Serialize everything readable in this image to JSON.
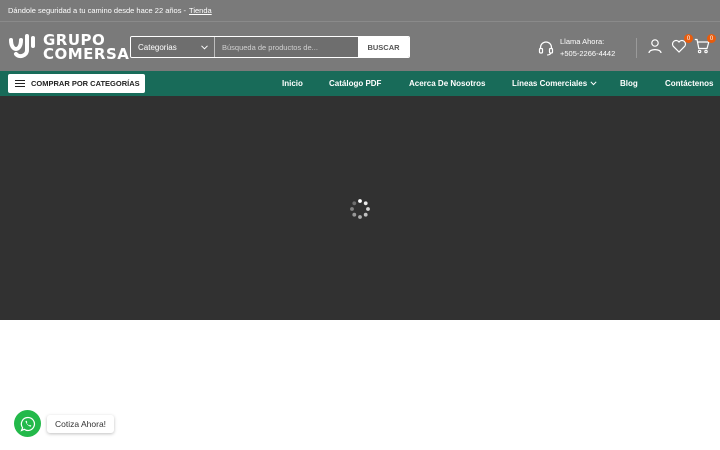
{
  "topbar": {
    "tagline": "Dándole seguridad a tu camino desde hace 22 años -",
    "link": "Tienda"
  },
  "header": {
    "logo_line1": "GRUPO",
    "logo_line2": "COMERSA",
    "search": {
      "category": "Categorias",
      "placeholder": "Búsqueda de productos de...",
      "button": "BUSCAR"
    },
    "call": {
      "label": "Llama Ahora:",
      "phone": "+505-2266-4442"
    },
    "wishlist_count": "0",
    "cart_count": "0"
  },
  "nav": {
    "categories_button": "COMPRAR POR CATEGORÍAS",
    "items": [
      "Inicio",
      "Catálogo PDF",
      "Acerca De Nosotros",
      "Líneas Comerciales",
      "Blog",
      "Contáctenos"
    ]
  },
  "whatsapp": {
    "label": "Cotiza Ahora!"
  },
  "colors": {
    "header_bg": "#7a7a7a",
    "nav_bg": "#186b59",
    "hero_bg": "#313131",
    "badge": "#e85c0d",
    "whatsapp": "#23b94a"
  }
}
